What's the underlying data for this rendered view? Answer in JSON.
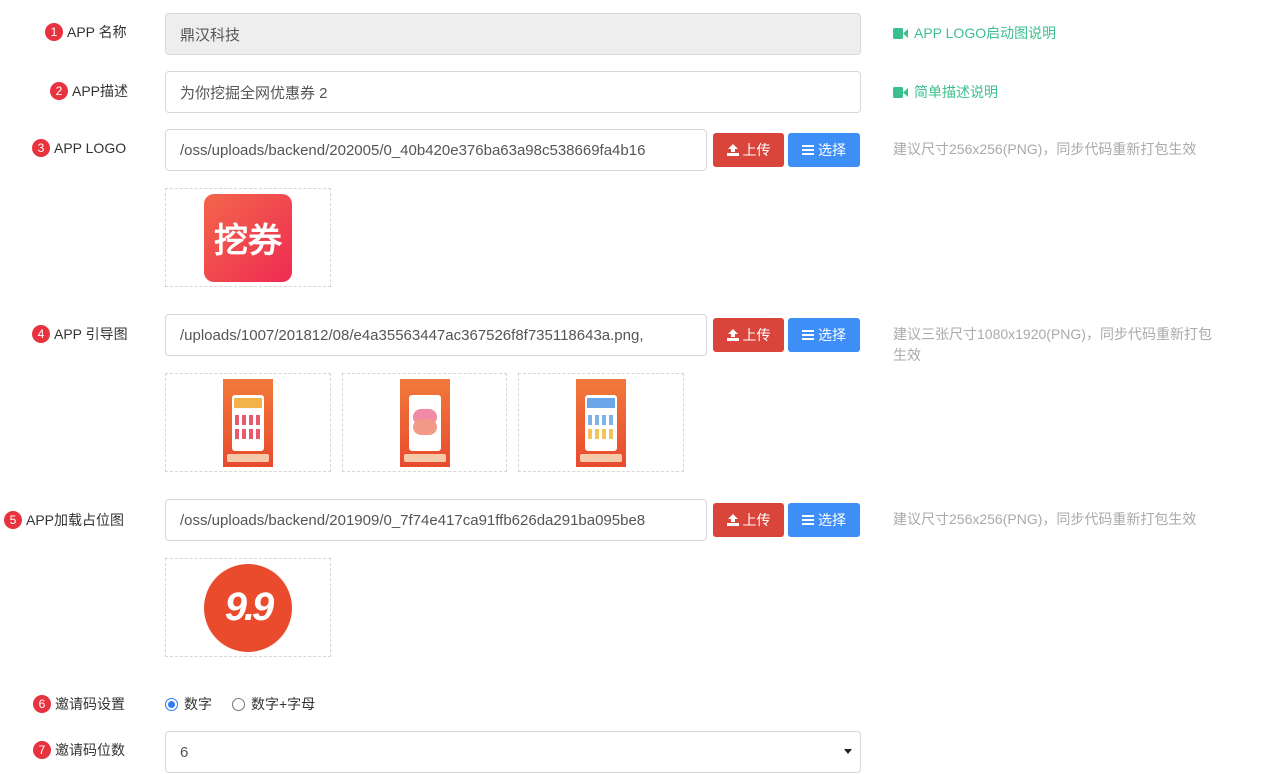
{
  "rows": {
    "app_name": {
      "badge": "1",
      "label": "APP 名称",
      "value": "鼎汉科技",
      "help": "APP LOGO启动图说明",
      "help_icon": "video-camera-icon"
    },
    "app_desc": {
      "badge": "2",
      "label": "APP描述",
      "value": "为你挖掘全网优惠券 2",
      "help": "简单描述说明",
      "help_icon": "video-camera-icon"
    },
    "app_logo": {
      "badge": "3",
      "label": "APP LOGO",
      "value": "/oss/uploads/backend/202005/0_40b420e376ba63a98c538669fa4b16",
      "upload": "上传",
      "select": "选择",
      "hint": "建议尺寸256x256(PNG)，同步代码重新打包生效",
      "preview_text": "挖券"
    },
    "app_guide": {
      "badge": "4",
      "label": "APP 引导图",
      "value": "/uploads/1007/201812/08/e4a35563447ac367526f8f735118643a.png,",
      "upload": "上传",
      "select": "选择",
      "hint": "建议三张尺寸1080x1920(PNG)，同步代码重新打包生效"
    },
    "app_placeholder": {
      "badge": "5",
      "label": "APP加载占位图",
      "value": "/oss/uploads/backend/201909/0_7f74e417ca91ffb626da291ba095be8",
      "upload": "上传",
      "select": "选择",
      "hint": "建议尺寸256x256(PNG)，同步代码重新打包生效",
      "preview_text": "9.9"
    },
    "invite_setting": {
      "badge": "6",
      "label": "邀请码设置",
      "options": [
        "数字",
        "数字+字母"
      ],
      "selected": "数字"
    },
    "invite_digits": {
      "badge": "7",
      "label": "邀请码位数",
      "value": "6"
    }
  },
  "colors": {
    "upload_button": "#d9453a",
    "select_button": "#3d8ef7",
    "help_link": "#3cbf8e",
    "badge": "#e8333f"
  }
}
